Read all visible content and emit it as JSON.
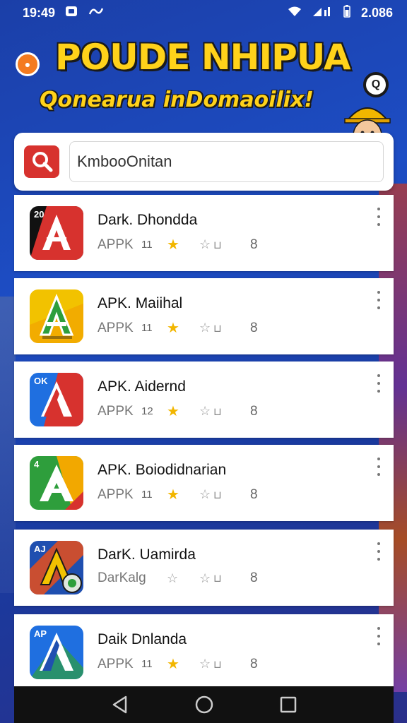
{
  "status_bar": {
    "time": "19:49",
    "right_text": "2.086",
    "icons": [
      "notification-icon",
      "link-icon",
      "wifi-icon",
      "signal-icon",
      "battery-icon"
    ]
  },
  "banner": {
    "title": "POUDE NHIPUA",
    "subtitle": "Qonearua inDomaoilix!",
    "title_color": "#ffd21a"
  },
  "search": {
    "placeholder": "KmbooOnitan",
    "value": "",
    "icon": "search-icon",
    "icon_bg": "#d7322e"
  },
  "apps": [
    {
      "name": "Dark. Dhondda",
      "type": "APPK",
      "size": "11",
      "rating_filled": 1,
      "count": "8",
      "icon_colors": [
        "#111111",
        "#d7322e"
      ],
      "icon_label": "20"
    },
    {
      "name": "APK. Maiihal",
      "type": "APPK",
      "size": "11",
      "rating_filled": 1,
      "count": "8",
      "icon_colors": [
        "#f2c200",
        "#2e9e3c"
      ],
      "icon_label": ""
    },
    {
      "name": "APK. Aidernd",
      "type": "APPK",
      "size": "12",
      "rating_filled": 1,
      "count": "8",
      "icon_colors": [
        "#1f6fe0",
        "#d7322e"
      ],
      "icon_label": "OK"
    },
    {
      "name": "APK. Boiodidnarian",
      "type": "APPK",
      "size": "11",
      "rating_filled": 1,
      "count": "8",
      "icon_colors": [
        "#2e9e3c",
        "#f2a800"
      ],
      "icon_label": "4"
    },
    {
      "name": "DarK. Uamirda",
      "type": "DarKalg",
      "size": "",
      "rating_filled": 0,
      "count": "8",
      "icon_colors": [
        "#1f4fb0",
        "#e84e1b"
      ],
      "icon_label": "AJ"
    },
    {
      "name": "Daik Dnlanda",
      "type": "APPK",
      "size": "11",
      "rating_filled": 1,
      "count": "8",
      "icon_colors": [
        "#1f6fe0",
        "#2e9e3c"
      ],
      "icon_label": "AP"
    }
  ],
  "nav": {
    "back": "back-icon",
    "home": "home-icon",
    "recents": "recents-icon"
  }
}
